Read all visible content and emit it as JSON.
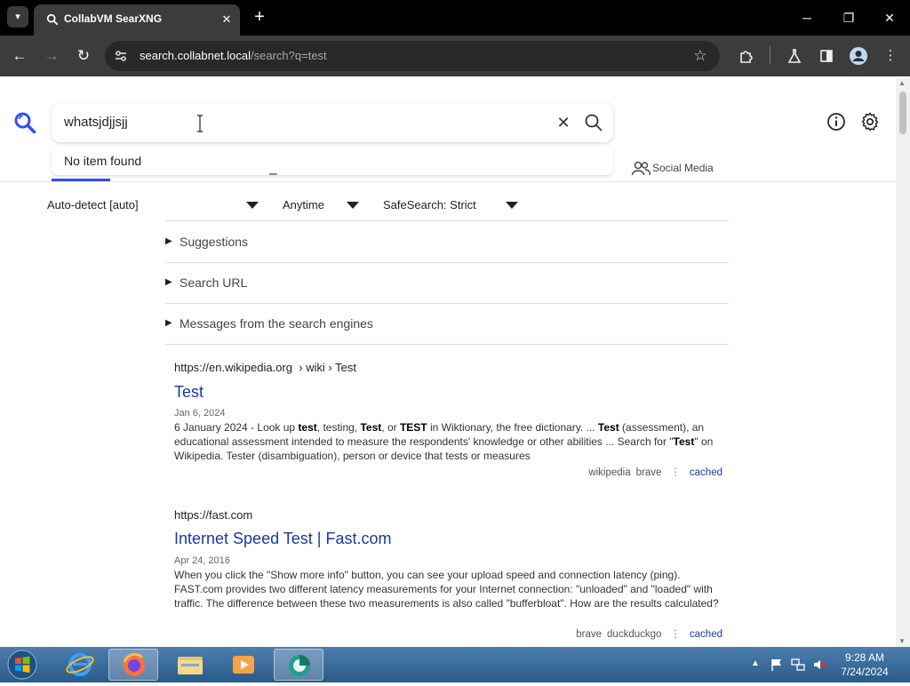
{
  "browser": {
    "tab_title": "CollabVM SearXNG",
    "url_host": "search.collabnet.local",
    "url_path": "/search?q=test"
  },
  "search": {
    "query": "whatsjdjjsjj",
    "dropdown_text": "No item found"
  },
  "categories": {
    "visible_item": "Social Media"
  },
  "filters": {
    "language": "Auto-detect [auto]",
    "time": "Anytime",
    "safesearch": "SafeSearch: Strict"
  },
  "sections": [
    {
      "label": "Suggestions"
    },
    {
      "label": "Search URL"
    },
    {
      "label": "Messages from the search engines"
    }
  ],
  "results": [
    {
      "url": "https://en.wikipedia.org",
      "breadcrumb": "› wiki › Test",
      "title": "Test",
      "date": "Jan 6, 2024",
      "engines": [
        "wikipedia",
        "brave"
      ],
      "cached": "cached"
    },
    {
      "url": "https://fast.com",
      "breadcrumb": "",
      "title": "Internet Speed Test | Fast.com",
      "date": "Apr 24, 2016",
      "engines": [
        "brave",
        "duckduckgo"
      ],
      "cached": "cached"
    }
  ],
  "snippets": {
    "r0_a": "6 January 2024 - Look up ",
    "r0_b": "test",
    "r0_c": ", testing, ",
    "r0_d": "Test",
    "r0_e": ", or ",
    "r0_f": "TEST",
    "r0_g": " in Wiktionary, the free dictionary. ... ",
    "r0_h": "Test",
    "r0_i": " (assessment), an educational assessment intended to measure the respondents' knowledge or other abilities ... Search for \"",
    "r0_j": "Test",
    "r0_k": "\" on Wikipedia. Tester (disambiguation), person or device that tests or measures",
    "r1": "When you click the \"Show more info\" button, you can see your upload speed and connection latency (ping). FAST.com provides two different latency measurements for your Internet connection: \"unloaded\" and \"loaded\" with traffic. The difference between these two measurements is also called \"bufferbloat\". How are the results calculated?"
  },
  "taskbar": {
    "time": "9:28 AM",
    "date": "7/24/2024"
  },
  "colors": {
    "accent": "#3050ff",
    "result_title": "#1a3a9c",
    "browser_dark": "#3c3c3c"
  },
  "icons": [
    "tab-list-icon",
    "searxng-favicon",
    "close-icon",
    "plus-icon",
    "minimize-icon",
    "restore-icon",
    "back-icon",
    "forward-icon",
    "reload-icon",
    "site-info-icon",
    "star-icon",
    "extensions-icon",
    "labs-icon",
    "sidepanel-icon",
    "profile-icon",
    "menu-icon",
    "search-logo-icon",
    "text-cursor-icon",
    "clear-icon",
    "search-icon",
    "info-icon",
    "gear-icon",
    "people-icon",
    "windows-start-icon",
    "ie-icon",
    "firefox-icon",
    "explorer-icon",
    "media-player-icon",
    "collabvm-icon",
    "flag-icon",
    "network-icon",
    "volume-muted-icon"
  ]
}
